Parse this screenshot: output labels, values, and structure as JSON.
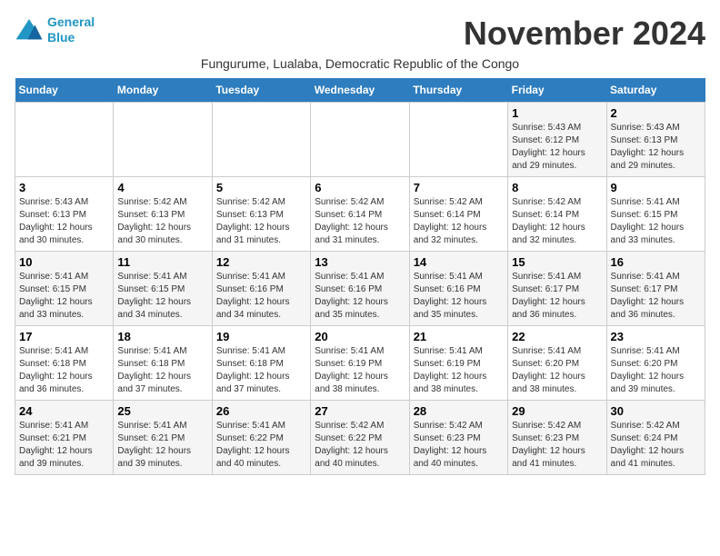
{
  "logo": {
    "line1": "General",
    "line2": "Blue"
  },
  "title": "November 2024",
  "subtitle": "Fungurume, Lualaba, Democratic Republic of the Congo",
  "days_of_week": [
    "Sunday",
    "Monday",
    "Tuesday",
    "Wednesday",
    "Thursday",
    "Friday",
    "Saturday"
  ],
  "weeks": [
    [
      {
        "num": "",
        "info": ""
      },
      {
        "num": "",
        "info": ""
      },
      {
        "num": "",
        "info": ""
      },
      {
        "num": "",
        "info": ""
      },
      {
        "num": "",
        "info": ""
      },
      {
        "num": "1",
        "info": "Sunrise: 5:43 AM\nSunset: 6:12 PM\nDaylight: 12 hours and 29 minutes."
      },
      {
        "num": "2",
        "info": "Sunrise: 5:43 AM\nSunset: 6:13 PM\nDaylight: 12 hours and 29 minutes."
      }
    ],
    [
      {
        "num": "3",
        "info": "Sunrise: 5:43 AM\nSunset: 6:13 PM\nDaylight: 12 hours and 30 minutes."
      },
      {
        "num": "4",
        "info": "Sunrise: 5:42 AM\nSunset: 6:13 PM\nDaylight: 12 hours and 30 minutes."
      },
      {
        "num": "5",
        "info": "Sunrise: 5:42 AM\nSunset: 6:13 PM\nDaylight: 12 hours and 31 minutes."
      },
      {
        "num": "6",
        "info": "Sunrise: 5:42 AM\nSunset: 6:14 PM\nDaylight: 12 hours and 31 minutes."
      },
      {
        "num": "7",
        "info": "Sunrise: 5:42 AM\nSunset: 6:14 PM\nDaylight: 12 hours and 32 minutes."
      },
      {
        "num": "8",
        "info": "Sunrise: 5:42 AM\nSunset: 6:14 PM\nDaylight: 12 hours and 32 minutes."
      },
      {
        "num": "9",
        "info": "Sunrise: 5:41 AM\nSunset: 6:15 PM\nDaylight: 12 hours and 33 minutes."
      }
    ],
    [
      {
        "num": "10",
        "info": "Sunrise: 5:41 AM\nSunset: 6:15 PM\nDaylight: 12 hours and 33 minutes."
      },
      {
        "num": "11",
        "info": "Sunrise: 5:41 AM\nSunset: 6:15 PM\nDaylight: 12 hours and 34 minutes."
      },
      {
        "num": "12",
        "info": "Sunrise: 5:41 AM\nSunset: 6:16 PM\nDaylight: 12 hours and 34 minutes."
      },
      {
        "num": "13",
        "info": "Sunrise: 5:41 AM\nSunset: 6:16 PM\nDaylight: 12 hours and 35 minutes."
      },
      {
        "num": "14",
        "info": "Sunrise: 5:41 AM\nSunset: 6:16 PM\nDaylight: 12 hours and 35 minutes."
      },
      {
        "num": "15",
        "info": "Sunrise: 5:41 AM\nSunset: 6:17 PM\nDaylight: 12 hours and 36 minutes."
      },
      {
        "num": "16",
        "info": "Sunrise: 5:41 AM\nSunset: 6:17 PM\nDaylight: 12 hours and 36 minutes."
      }
    ],
    [
      {
        "num": "17",
        "info": "Sunrise: 5:41 AM\nSunset: 6:18 PM\nDaylight: 12 hours and 36 minutes."
      },
      {
        "num": "18",
        "info": "Sunrise: 5:41 AM\nSunset: 6:18 PM\nDaylight: 12 hours and 37 minutes."
      },
      {
        "num": "19",
        "info": "Sunrise: 5:41 AM\nSunset: 6:18 PM\nDaylight: 12 hours and 37 minutes."
      },
      {
        "num": "20",
        "info": "Sunrise: 5:41 AM\nSunset: 6:19 PM\nDaylight: 12 hours and 38 minutes."
      },
      {
        "num": "21",
        "info": "Sunrise: 5:41 AM\nSunset: 6:19 PM\nDaylight: 12 hours and 38 minutes."
      },
      {
        "num": "22",
        "info": "Sunrise: 5:41 AM\nSunset: 6:20 PM\nDaylight: 12 hours and 38 minutes."
      },
      {
        "num": "23",
        "info": "Sunrise: 5:41 AM\nSunset: 6:20 PM\nDaylight: 12 hours and 39 minutes."
      }
    ],
    [
      {
        "num": "24",
        "info": "Sunrise: 5:41 AM\nSunset: 6:21 PM\nDaylight: 12 hours and 39 minutes."
      },
      {
        "num": "25",
        "info": "Sunrise: 5:41 AM\nSunset: 6:21 PM\nDaylight: 12 hours and 39 minutes."
      },
      {
        "num": "26",
        "info": "Sunrise: 5:41 AM\nSunset: 6:22 PM\nDaylight: 12 hours and 40 minutes."
      },
      {
        "num": "27",
        "info": "Sunrise: 5:42 AM\nSunset: 6:22 PM\nDaylight: 12 hours and 40 minutes."
      },
      {
        "num": "28",
        "info": "Sunrise: 5:42 AM\nSunset: 6:23 PM\nDaylight: 12 hours and 40 minutes."
      },
      {
        "num": "29",
        "info": "Sunrise: 5:42 AM\nSunset: 6:23 PM\nDaylight: 12 hours and 41 minutes."
      },
      {
        "num": "30",
        "info": "Sunrise: 5:42 AM\nSunset: 6:24 PM\nDaylight: 12 hours and 41 minutes."
      }
    ]
  ]
}
